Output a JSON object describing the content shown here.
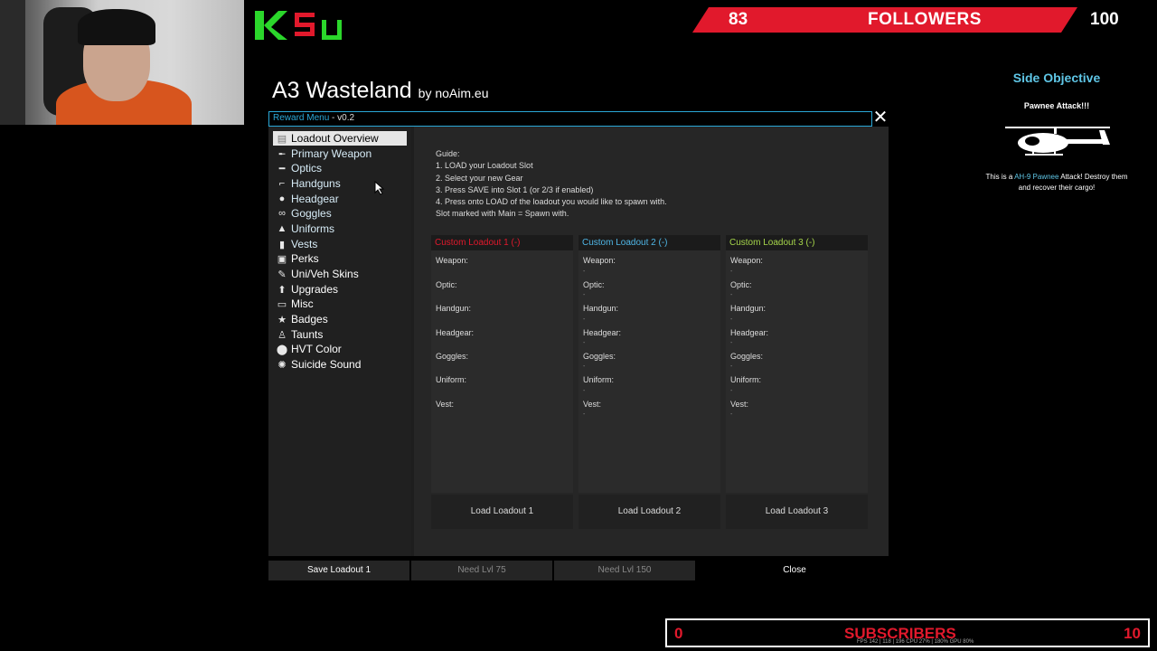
{
  "stream_overlay": {
    "followers": {
      "current": "83",
      "label": "FOLLOWERS",
      "goal": "100"
    },
    "subscribers": {
      "current": "0",
      "label": "SUBSCRIBERS",
      "goal": "10"
    },
    "perf_stats": "FPS 142 | 118 | 196     CPU 27% | 180%     GPU 80%",
    "logo_text": "K5u"
  },
  "game": {
    "title": "A3 Wasteland",
    "by": "by noAim.eu"
  },
  "window": {
    "title_accent": "Reward Menu",
    "title_rest": " - v0.2",
    "close_glyph": "✕"
  },
  "sidebar": {
    "items": [
      {
        "label": "Loadout Overview",
        "icon": "list-icon"
      },
      {
        "label": "Primary Weapon",
        "icon": "rifle-icon"
      },
      {
        "label": "Optics",
        "icon": "scope-icon"
      },
      {
        "label": "Handguns",
        "icon": "pistol-icon"
      },
      {
        "label": "Headgear",
        "icon": "helmet-icon"
      },
      {
        "label": "Goggles",
        "icon": "goggles-icon"
      },
      {
        "label": "Uniforms",
        "icon": "uniform-icon"
      },
      {
        "label": "Vests",
        "icon": "vest-icon"
      },
      {
        "label": "Perks",
        "icon": "crate-icon"
      },
      {
        "label": "Uni/Veh Skins",
        "icon": "paint-icon"
      },
      {
        "label": "Upgrades",
        "icon": "arrow-up-icon"
      },
      {
        "label": "Misc",
        "icon": "box-icon"
      },
      {
        "label": "Badges",
        "icon": "star-icon"
      },
      {
        "label": "Taunts",
        "icon": "person-icon"
      },
      {
        "label": "HVT Color",
        "icon": "marker-icon"
      },
      {
        "label": "Suicide Sound",
        "icon": "explosion-icon"
      }
    ]
  },
  "guide": {
    "lines": [
      "Guide:",
      "1. LOAD your Loadout Slot",
      "2. Select your new Gear",
      "3. Press SAVE into Slot 1 (or 2/3 if enabled)",
      "4. Press onto LOAD of the loadout you would like to spawn with.",
      "Slot marked with Main = Spawn with."
    ]
  },
  "loadouts": [
    {
      "title": "Custom Loadout 1 (-)",
      "color": "#e1192c",
      "load_label": "Load Loadout 1",
      "fields": [
        "Weapon:",
        "Optic:",
        "Handgun:",
        "Headgear:",
        "Goggles:",
        "Uniform:",
        "Vest:"
      ],
      "value": ""
    },
    {
      "title": "Custom Loadout 2 (-)",
      "color": "#4fb6e6",
      "load_label": "Load Loadout 2",
      "fields": [
        "Weapon:",
        "Optic:",
        "Handgun:",
        "Headgear:",
        "Goggles:",
        "Uniform:",
        "Vest:"
      ],
      "value": "-"
    },
    {
      "title": "Custom Loadout 3 (-)",
      "color": "#a6d64a",
      "load_label": "Load Loadout 3",
      "fields": [
        "Weapon:",
        "Optic:",
        "Handgun:",
        "Headgear:",
        "Goggles:",
        "Uniform:",
        "Vest:"
      ],
      "value": "-"
    }
  ],
  "bottom_buttons": {
    "save": "Save Loadout 1",
    "slot2": "Need Lvl 75",
    "slot3": "Need Lvl 150",
    "close": "Close"
  },
  "side_objective": {
    "title": "Side Objective",
    "subtitle": "Pawnee Attack!!!",
    "desc_prefix": "This is a ",
    "desc_vehicle": "AH-9 Pawnee",
    "desc_suffix": " Attack! Destroy them and recover their cargo!"
  },
  "colors": {
    "accent_blue": "#2aa8d8",
    "follower_red": "#e1192c",
    "nav_text": "#d7ecf7"
  }
}
